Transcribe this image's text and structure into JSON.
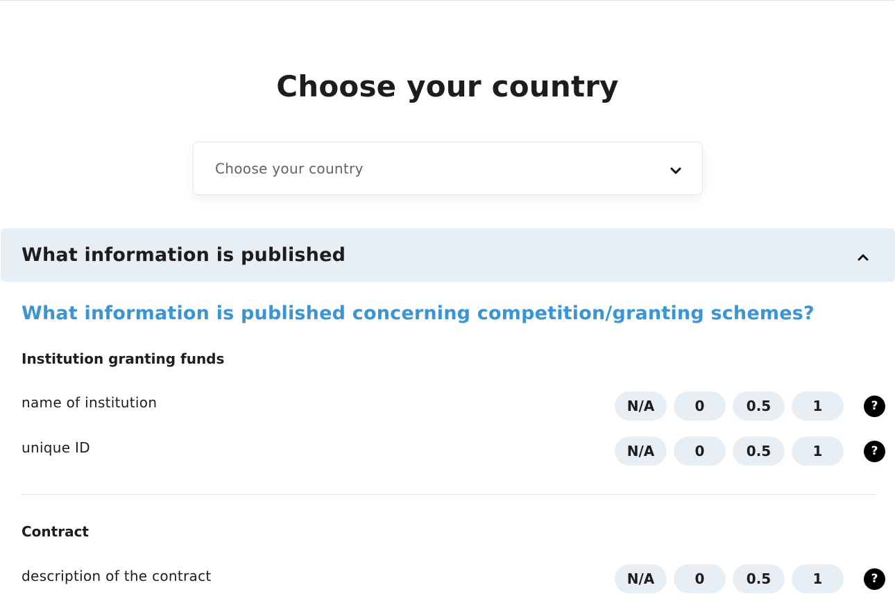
{
  "page": {
    "title": "Choose your country"
  },
  "country_select": {
    "placeholder": "Choose your country"
  },
  "accordion": {
    "title": "What information is published",
    "question": "What information is published concerning competition/granting schemes?",
    "groups": [
      {
        "title": "Institution granting funds",
        "rows": [
          {
            "label": "name of institution"
          },
          {
            "label": "unique ID"
          }
        ]
      },
      {
        "title": "Contract",
        "rows": [
          {
            "label": "description of the contract"
          }
        ]
      }
    ]
  },
  "score_options": [
    "N/A",
    "0",
    "0.5",
    "1"
  ],
  "help_symbol": "?",
  "icons": {
    "select": "chevron-down-icon",
    "accordion": "chevron-up-icon",
    "help": "question-mark-icon"
  },
  "colors": {
    "accent": "#3a95d6",
    "pill_bg": "#e8eff4",
    "header_bg": "#e8eff4"
  }
}
